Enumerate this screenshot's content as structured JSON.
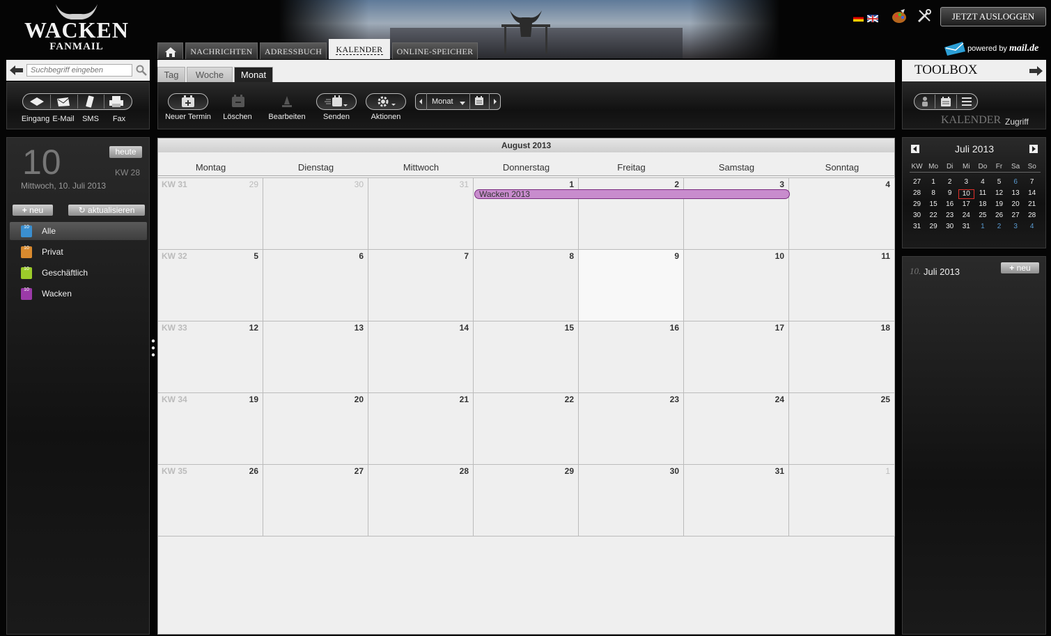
{
  "app": {
    "logo_main": "WACKEN",
    "logo_sub": "FANMAIL"
  },
  "nav": {
    "tabs": [
      {
        "label": "NACHRICHTEN"
      },
      {
        "label": "ADRESSBUCH"
      },
      {
        "label": "KALENDER"
      },
      {
        "label": "ONLINE-SPEICHER"
      }
    ],
    "logout": "JETZT AUSLOGGEN",
    "powered_prefix": "powered by",
    "powered_brand": "mail.de"
  },
  "search": {
    "placeholder": "Suchbegriff eingeben"
  },
  "quick": {
    "items": [
      {
        "label": "Eingang"
      },
      {
        "label": "E-Mail"
      },
      {
        "label": "SMS"
      },
      {
        "label": "Fax"
      }
    ]
  },
  "view_tabs": [
    {
      "label": "Tag"
    },
    {
      "label": "Woche"
    },
    {
      "label": "Monat"
    }
  ],
  "toolbar": {
    "new": "Neuer Termin",
    "delete": "Löschen",
    "edit": "Bearbeiten",
    "send": "Senden",
    "actions": "Aktionen",
    "view_select": "Monat"
  },
  "today": {
    "day": "10",
    "button": "heute",
    "week": "KW 28",
    "date": "Mittwoch, 10. Juli 2013",
    "new": "neu",
    "refresh": "aktualisieren"
  },
  "calendars": [
    {
      "label": "Alle",
      "color": "#3a8fd0"
    },
    {
      "label": "Privat",
      "color": "#d98a2e"
    },
    {
      "label": "Geschäftlich",
      "color": "#9ccc2a"
    },
    {
      "label": "Wacken",
      "color": "#9b3aa8"
    }
  ],
  "month": {
    "title": "August 2013",
    "weekdays": [
      "Montag",
      "Dienstag",
      "Mittwoch",
      "Donnerstag",
      "Freitag",
      "Samstag",
      "Sonntag"
    ],
    "weeks": [
      {
        "kw": "KW 31",
        "days": [
          "29",
          "30",
          "31",
          "1",
          "2",
          "3",
          "4"
        ],
        "other": [
          true,
          true,
          true,
          false,
          false,
          false,
          false
        ]
      },
      {
        "kw": "KW 32",
        "days": [
          "5",
          "6",
          "7",
          "8",
          "9",
          "10",
          "11"
        ],
        "other": [
          false,
          false,
          false,
          false,
          false,
          false,
          false
        ]
      },
      {
        "kw": "KW 33",
        "days": [
          "12",
          "13",
          "14",
          "15",
          "16",
          "17",
          "18"
        ],
        "other": [
          false,
          false,
          false,
          false,
          false,
          false,
          false
        ]
      },
      {
        "kw": "KW 34",
        "days": [
          "19",
          "20",
          "21",
          "22",
          "23",
          "24",
          "25"
        ],
        "other": [
          false,
          false,
          false,
          false,
          false,
          false,
          false
        ]
      },
      {
        "kw": "KW 35",
        "days": [
          "26",
          "27",
          "28",
          "29",
          "30",
          "31",
          "1"
        ],
        "other": [
          false,
          false,
          false,
          false,
          false,
          false,
          true
        ]
      }
    ],
    "event": {
      "title": "Wacken 2013",
      "color": "#c88ccd"
    }
  },
  "toolbox": {
    "title": "TOOLBOX",
    "caption_main": "KALENDER",
    "caption_sub": "Zugriff"
  },
  "minical": {
    "title": "Juli 2013",
    "headers": [
      "KW",
      "Mo",
      "Di",
      "Mi",
      "Do",
      "Fr",
      "Sa",
      "So"
    ],
    "rows": [
      [
        "27",
        "1",
        "2",
        "3",
        "4",
        "5",
        "6",
        "7"
      ],
      [
        "28",
        "8",
        "9",
        "10",
        "11",
        "12",
        "13",
        "14"
      ],
      [
        "29",
        "15",
        "16",
        "17",
        "18",
        "19",
        "20",
        "21"
      ],
      [
        "30",
        "22",
        "23",
        "24",
        "25",
        "26",
        "27",
        "28"
      ],
      [
        "31",
        "29",
        "30",
        "31",
        "1",
        "2",
        "3",
        "4"
      ]
    ]
  },
  "agenda": {
    "day": "10.",
    "month": "Juli 2013",
    "new": "neu"
  }
}
